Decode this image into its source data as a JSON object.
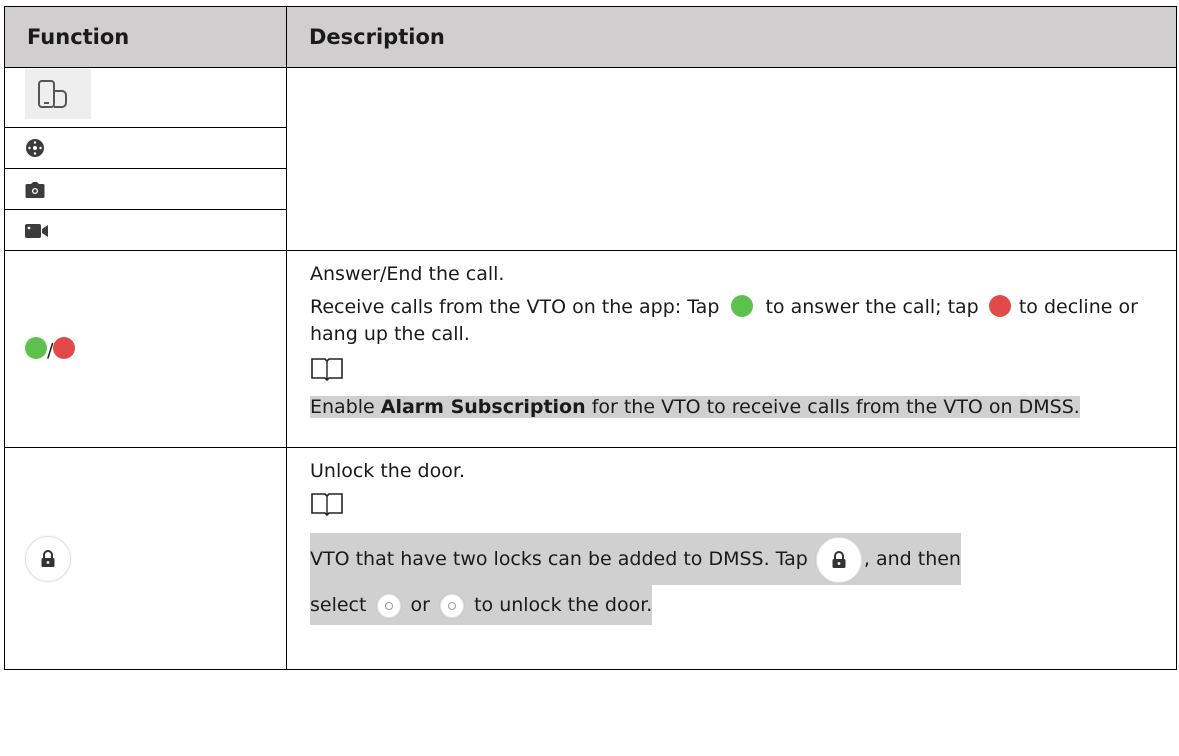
{
  "header": {
    "function": "Function",
    "description": "Description"
  },
  "rows": {
    "call_desc_title": "Answer/End the call.",
    "call_desc_part1": "Receive calls from the VTO on the app: Tap",
    "call_desc_part2": "to answer the call; tap",
    "call_desc_part3": "to decline or hang up the call.",
    "call_note_part1": "Enable",
    "call_note_bold": "Alarm Subscription",
    "call_note_part2": "for the VTO to receive calls from the VTO on DMSS.",
    "call_slash": "/",
    "unlock_title": "Unlock the door.",
    "unlock_note_part1": "VTO that have two locks can be added to DMSS. Tap",
    "unlock_note_part2": ", and then",
    "unlock_note_part3": "select",
    "unlock_note_part4": "or",
    "unlock_note_part5": "to unlock the door."
  },
  "icons": {
    "row1": "phone-device-icon",
    "row2": "ptz-dial-icon",
    "row3": "camera-snapshot-icon",
    "row4": "video-record-icon",
    "answer": "answer-call-icon",
    "end": "end-call-icon",
    "lock": "lock-icon",
    "note": "note-book-icon"
  },
  "colors": {
    "header_bg": "#d0cece",
    "highlight": "#d0d0d0",
    "answer_green": "#5cc24d",
    "end_red": "#e24a4a"
  }
}
